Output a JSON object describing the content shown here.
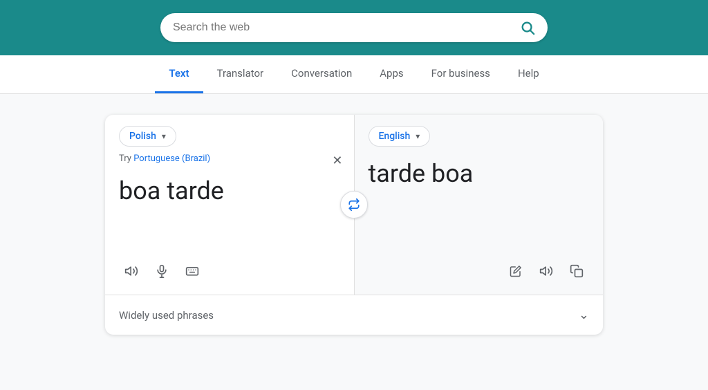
{
  "header": {
    "search_placeholder": "Search the web",
    "bg_color": "#1a8a8a"
  },
  "nav": {
    "items": [
      {
        "label": "Text",
        "active": true
      },
      {
        "label": "Translator",
        "active": false
      },
      {
        "label": "Conversation",
        "active": false
      },
      {
        "label": "Apps",
        "active": false
      },
      {
        "label": "For business",
        "active": false
      },
      {
        "label": "Help",
        "active": false
      }
    ]
  },
  "translator": {
    "source_lang": "Polish",
    "target_lang": "English",
    "try_prefix": "Try",
    "try_lang": "Portuguese (Brazil)",
    "input_text": "boa tarde",
    "output_text": "tarde boa",
    "phrases_label": "Widely used phrases"
  }
}
